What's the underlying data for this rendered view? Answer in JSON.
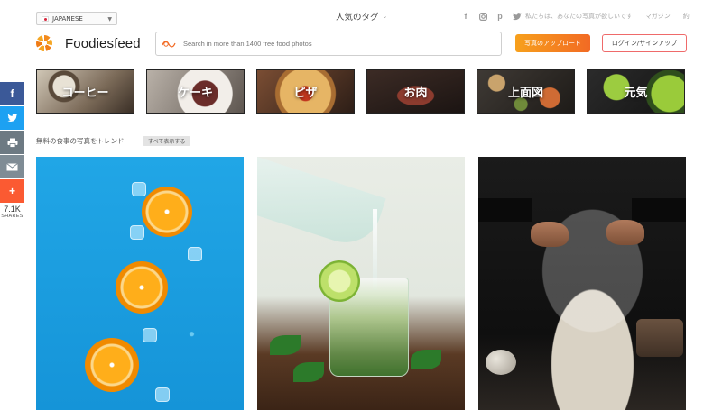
{
  "top_bar": {
    "language": "JAPANESE",
    "popular_tags": "人気のタグ",
    "social_icons": [
      "facebook-icon",
      "instagram-icon",
      "pinterest-icon",
      "twitter-icon"
    ],
    "links": [
      "私たちは、あなたの写真が欲しいです",
      "マガジン",
      "約"
    ]
  },
  "header": {
    "logo_text": "Foodiesfeed",
    "search_placeholder": "Search in more than 1400 free food photos",
    "upload_label": "写真のアップロード",
    "login_label": "ログイン/サインアップ"
  },
  "share": {
    "buttons": [
      {
        "glyph": "f",
        "icon": "facebook-icon"
      },
      {
        "glyph": "t",
        "icon": "twitter-icon"
      },
      {
        "glyph": "⎙",
        "icon": "print-icon"
      },
      {
        "glyph": "✉",
        "icon": "email-icon"
      },
      {
        "glyph": "+",
        "icon": "plus-icon"
      }
    ],
    "count": "7.1K",
    "label": "SHARES"
  },
  "categories": [
    {
      "label": "コーヒー"
    },
    {
      "label": "ケーキ"
    },
    {
      "label": "ピザ"
    },
    {
      "label": "お肉"
    },
    {
      "label": "上面図"
    },
    {
      "label": "元気"
    }
  ],
  "trending": {
    "title": "無料の食事の写真をトレンド",
    "see_all": "すべて表示する"
  },
  "colors": {
    "accent_gradient_start": "#f7a01c",
    "accent_gradient_end": "#f26a24",
    "login_border": "#ef6a6a",
    "facebook": "#3b5998",
    "twitter": "#1da1f2",
    "share_more": "#fb5a32"
  }
}
